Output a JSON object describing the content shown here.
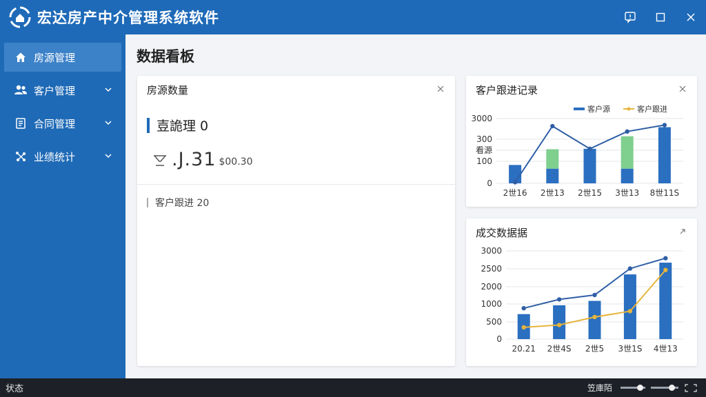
{
  "app": {
    "title": "宏达房产中介管理系统软件"
  },
  "sidebar": {
    "items": [
      {
        "label": "房源管理",
        "icon": "home-icon",
        "active": true,
        "expandable": false
      },
      {
        "label": "客户管理",
        "icon": "users-icon",
        "active": false,
        "expandable": true
      },
      {
        "label": "合同管理",
        "icon": "contract-icon",
        "active": false,
        "expandable": true
      },
      {
        "label": "业绩统计",
        "icon": "stats-icon",
        "active": false,
        "expandable": true
      }
    ]
  },
  "main": {
    "page_title": "数据看板",
    "house_card": {
      "title": "房源数量",
      "stat_text": "壴詭理 0",
      "metric_main": ".J.31",
      "metric_sub": "$00.30",
      "follow_text": "客户跟进 20"
    },
    "follow_card": {
      "title": "客户跟进记录",
      "close": "×"
    },
    "deal_card": {
      "title": "成交数据据",
      "close": "↗"
    }
  },
  "status_bar": {
    "status": "状态",
    "zoom_label": "笠庫陌",
    "slider1_level": 0.78,
    "slider2_level": 0.75
  },
  "colors": {
    "brand": "#1e6ab8",
    "sidebar": "#1f6ab6",
    "bar_blue": "#2a6fc0",
    "bar_green": "#7fcf8e",
    "line_blue": "#2f5fa6",
    "line_orange": "#e6b43c"
  },
  "chart_data": [
    {
      "type": "bar",
      "title": "客户跟进记录",
      "categories": [
        "2世16",
        "2世13",
        "2世15",
        "3世13",
        "8世11S"
      ],
      "series": [
        {
          "name": "客户源",
          "kind": "bar",
          "values": [
            85,
            68,
            160,
            68,
            260
          ],
          "color": "#2a6fc0"
        },
        {
          "name": "",
          "kind": "bar-stack",
          "values": [
            0,
            90,
            0,
            150,
            0
          ],
          "color": "#7fcf8e"
        },
        {
          "name": "客户跟进",
          "kind": "line",
          "values": [
            5,
            265,
            160,
            240,
            270
          ],
          "color": "#2f5fa6"
        }
      ],
      "y_ticks": [
        "3000",
        "300",
        "看源",
        "100",
        "0"
      ],
      "legend_position": "top-right",
      "grid": true
    },
    {
      "type": "bar",
      "title": "成交数据据",
      "categories": [
        "20.21",
        "2世4S",
        "2世5",
        "3世1S",
        "4世13"
      ],
      "series": [
        {
          "name": "",
          "kind": "bar",
          "values": [
            850,
            1150,
            1300,
            2200,
            2600
          ],
          "color": "#2a6fc0"
        },
        {
          "name": "",
          "kind": "line",
          "values": [
            1050,
            1350,
            1500,
            2400,
            2750
          ],
          "color": "#2f5fa6"
        },
        {
          "name": "",
          "kind": "line",
          "values": [
            400,
            480,
            750,
            950,
            2350
          ],
          "color": "#e6b43c"
        }
      ],
      "y_ticks": [
        "3000",
        "2500",
        "2000",
        "1000",
        "500",
        "0"
      ],
      "ylim": [
        0,
        3000
      ],
      "grid": true
    }
  ]
}
